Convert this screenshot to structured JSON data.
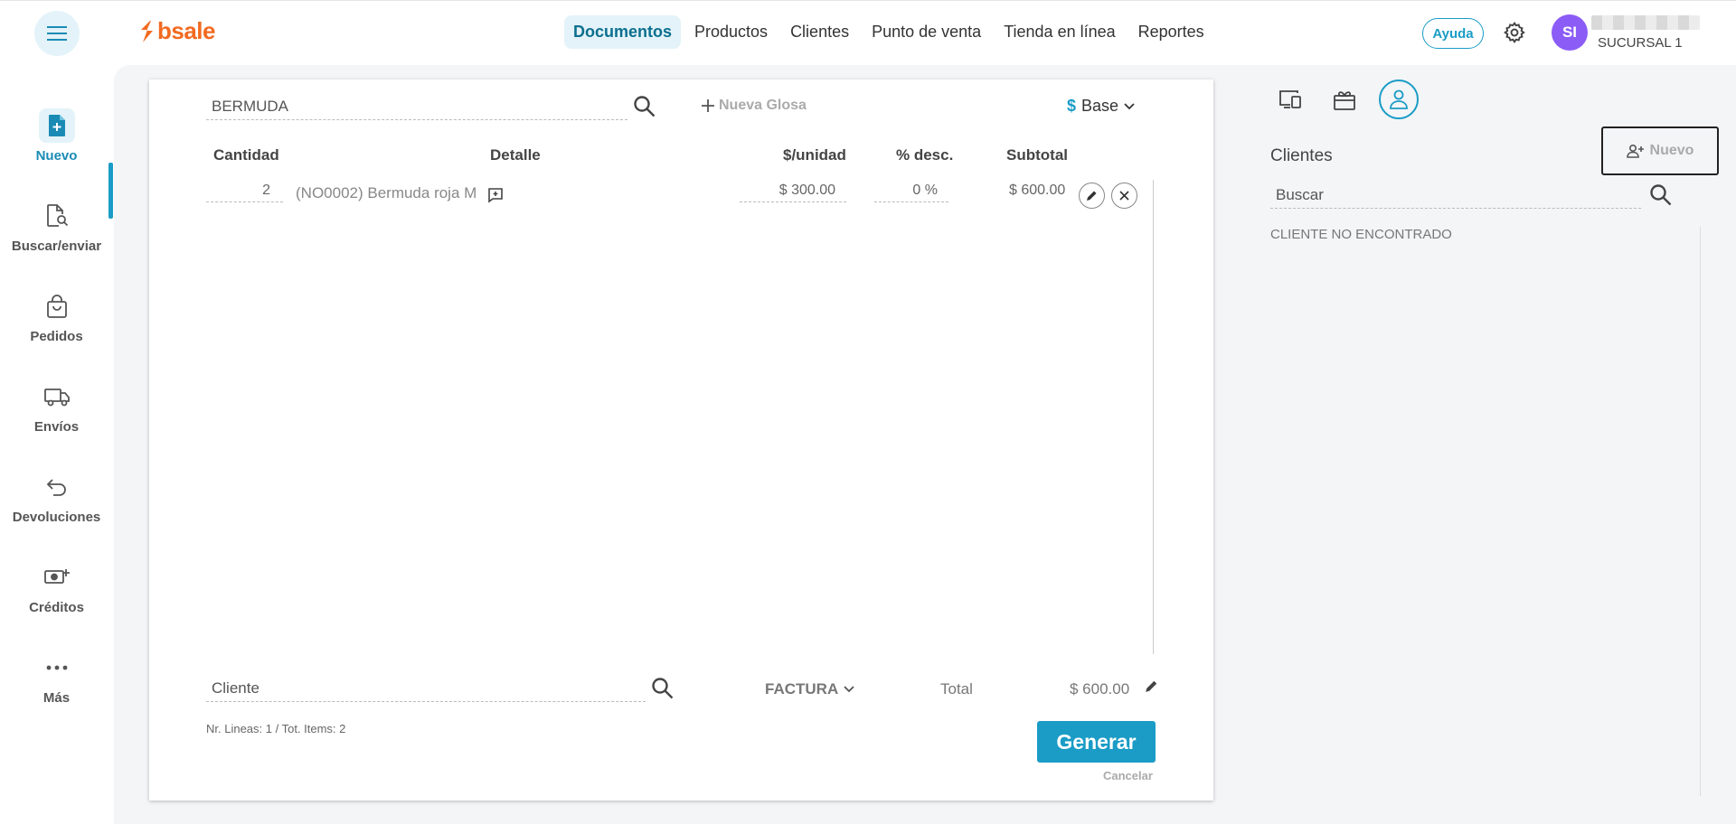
{
  "header": {
    "logo_text": "bsale",
    "nav": [
      {
        "label": "Documentos"
      },
      {
        "label": "Productos"
      },
      {
        "label": "Clientes"
      },
      {
        "label": "Punto de venta"
      },
      {
        "label": "Tienda en línea"
      },
      {
        "label": "Reportes"
      }
    ],
    "help_label": "Ayuda",
    "avatar_initials": "SI",
    "branch": "SUCURSAL 1"
  },
  "sidebar": {
    "items": [
      {
        "label": "Nuevo",
        "icon": "new-document-icon"
      },
      {
        "label": "Buscar/enviar",
        "icon": "search-document-icon"
      },
      {
        "label": "Pedidos",
        "icon": "shopping-bag-icon"
      },
      {
        "label": "Envíos",
        "icon": "truck-icon"
      },
      {
        "label": "Devoluciones",
        "icon": "return-arrow-icon"
      },
      {
        "label": "Créditos",
        "icon": "money-plus-icon"
      },
      {
        "label": "Más",
        "icon": "more-dots-icon"
      }
    ]
  },
  "document": {
    "product_search_value": "BERMUDA",
    "new_gloss_label": "Nueva Glosa",
    "price_list_symbol": "$",
    "price_list_label": "Base",
    "columns": {
      "qty": "Cantidad",
      "detail": "Detalle",
      "unit_price": "$/unidad",
      "discount": "% desc.",
      "subtotal": "Subtotal"
    },
    "rows": [
      {
        "qty": "2",
        "detail": "(NO0002) Bermuda roja M",
        "unit_price": "$ 300.00",
        "discount": "0 %",
        "subtotal": "$ 600.00"
      }
    ],
    "client_placeholder": "Cliente",
    "doc_type": "FACTURA",
    "total_label": "Total",
    "total_value": "$ 600.00",
    "summary": "Nr. Lineas: 1 / Tot. Items: 2",
    "generate_label": "Generar",
    "cancel_label": "Cancelar"
  },
  "clients_panel": {
    "title": "Clientes",
    "new_label": "Nuevo",
    "search_placeholder": "Buscar",
    "not_found": "CLIENTE NO ENCONTRADO"
  },
  "colors": {
    "accent": "#1a9cc6",
    "brand": "#f26a21",
    "avatar": "#8b5cf6"
  }
}
